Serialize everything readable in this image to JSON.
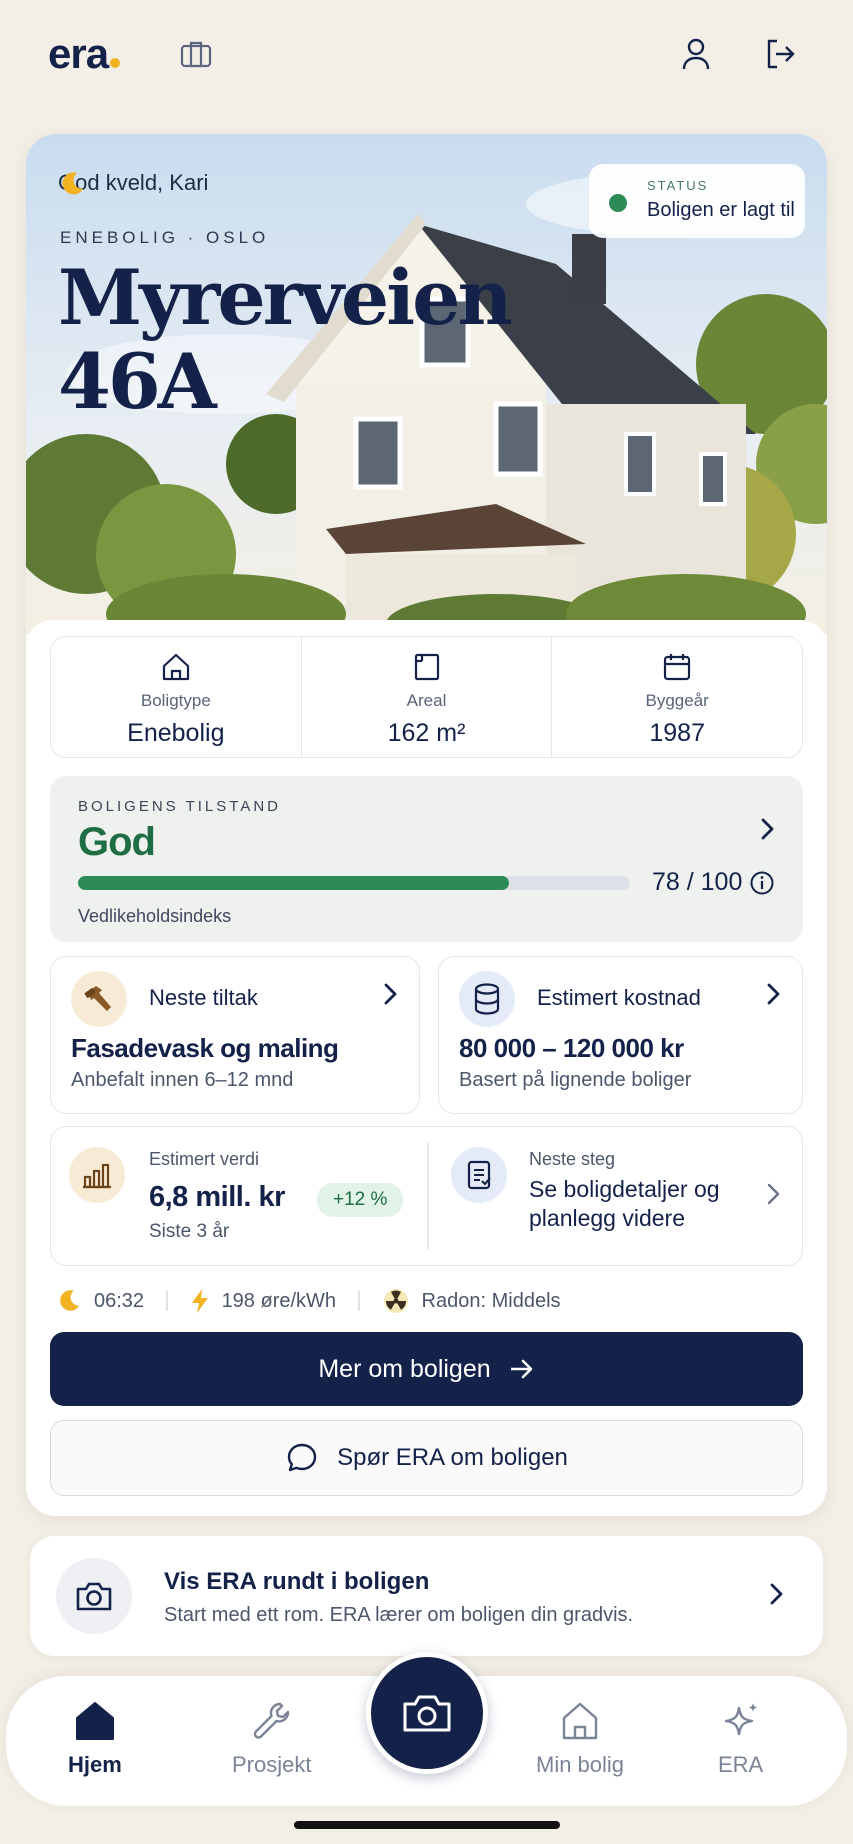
{
  "app": {
    "logo": "era",
    "greeting": "God kveld, Kari",
    "status": {
      "label": "STATUS",
      "text": "Boligen er lagt til"
    },
    "property_type_line": "ENEBOLIG · OSLO",
    "address": "Myrerveien 46A"
  },
  "facts": [
    {
      "label": "Boligtype",
      "value": "Enebolig",
      "icon": "house-icon"
    },
    {
      "label": "Areal",
      "value": "162 m²",
      "icon": "area-icon"
    },
    {
      "label": "Byggeår",
      "value": "1987",
      "icon": "calendar-icon"
    }
  ],
  "condition": {
    "label": "BOLIGENS TILSTAND",
    "value": "God",
    "score_text": "78 / 100",
    "score": 78,
    "max": 100,
    "subtitle": "Vedlikeholdsindeks"
  },
  "next_action": {
    "title": "Neste tiltak",
    "headline": "Fasadevask og maling",
    "subtitle": "Anbefalt innen 6–12 mnd",
    "icon": "hammer-icon"
  },
  "estimated_cost": {
    "title": "Estimert kostnad",
    "headline": "80 000 – 120 000 kr",
    "subtitle": "Basert på lignende boliger",
    "icon": "database-icon"
  },
  "estimated_value": {
    "label": "Estimert verdi",
    "value": "6,8 mill. kr",
    "badge": "+12 %",
    "subtitle": "Siste 3 år",
    "icon": "chart-icon"
  },
  "next_step": {
    "label": "Neste steg",
    "text": "Se boligdetaljer og planlegg videre",
    "icon": "document-icon"
  },
  "info_row": {
    "time": "06:32",
    "power_price": "198 øre/kWh",
    "radon": "Radon: Middels"
  },
  "buttons": {
    "primary": "Mer om boligen",
    "secondary": "Spør ERA om boligen"
  },
  "tour": {
    "title": "Vis ERA rundt i boligen",
    "subtitle": "Start med ett rom. ERA lærer om boligen din gradvis."
  },
  "nav": {
    "home": "Hjem",
    "project": "Prosjekt",
    "my_home": "Min bolig",
    "era": "ERA"
  },
  "colors": {
    "navy": "#14224a",
    "green": "#2e8b57",
    "background": "#f3efe7",
    "accent_yellow": "#f2b322"
  }
}
